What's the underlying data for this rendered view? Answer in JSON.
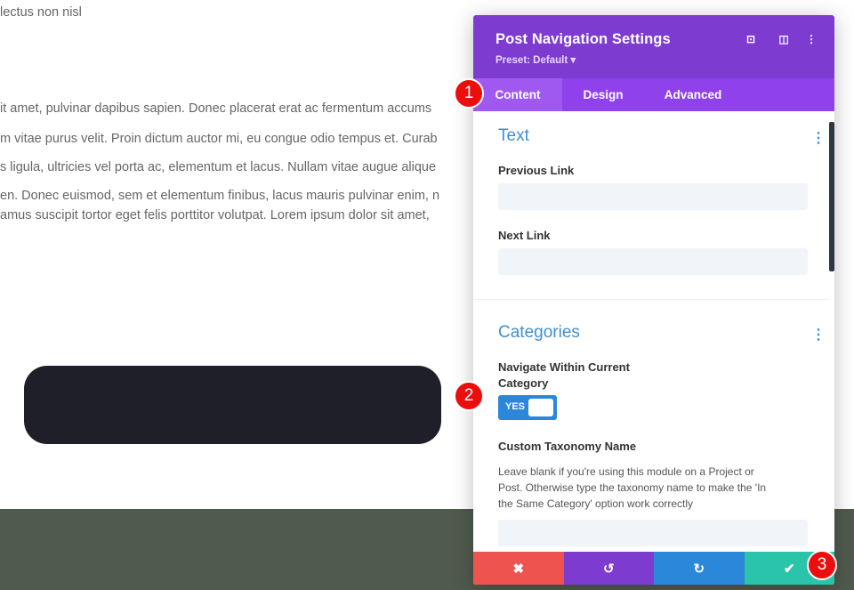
{
  "page": {
    "lines": [
      "lectus non nisl",
      "it amet, pulvinar dapibus sapien. Donec placerat erat ac fermentum accums",
      "m vitae purus velit. Proin dictum auctor mi, eu congue odio tempus et. Curab",
      "s ligula, ultricies vel porta ac, elementum et lacus. Nullam vitae augue alique",
      "en. Donec euismod, sem et elementum finibus, lacus mauris pulvinar enim, n",
      "amus suscipit tortor eget felis porttitor volutpat. Lorem ipsum dolor sit amet,"
    ]
  },
  "panel": {
    "title": "Post Navigation Settings",
    "preset": "Preset: Default ▾",
    "icons": {
      "expand": "⊡",
      "split": "◫",
      "more": "⋮"
    },
    "tabs": [
      {
        "label": "Content"
      },
      {
        "label": "Design"
      },
      {
        "label": "Advanced"
      }
    ],
    "text_section": {
      "title": "Text",
      "more": "⋮",
      "previous_label": "Previous Link",
      "previous_value": "",
      "next_label": "Next Link",
      "next_value": ""
    },
    "categories_section": {
      "title": "Categories",
      "more": "⋮",
      "navigate_label_1": "Navigate Within Current",
      "navigate_label_2": "Category",
      "toggle_label": "YES",
      "taxonomy_label": "Custom Taxonomy Name",
      "taxonomy_desc_1": "Leave blank if you're using this module on a Project or",
      "taxonomy_desc_2": "Post. Otherwise type the taxonomy name to make the 'In",
      "taxonomy_desc_3": "the Same Category' option work correctly",
      "taxonomy_value": ""
    },
    "actions": {
      "cancel": "✖",
      "undo": "↺",
      "redo": "↻",
      "save": "✔"
    },
    "colors": {
      "cancel": "#ef5350",
      "undo": "#7e3bd0",
      "redo": "#2b87da",
      "save": "#29c4a9"
    }
  },
  "callouts": [
    "1",
    "2",
    "3"
  ]
}
